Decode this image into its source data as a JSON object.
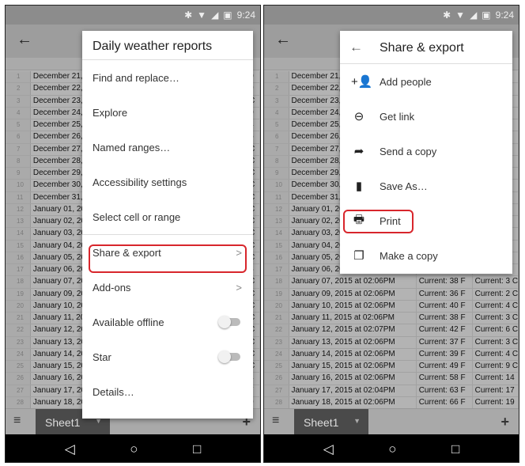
{
  "status": {
    "time": "9:24",
    "icons": [
      "bluetooth-icon",
      "wifi-icon",
      "signal-icon",
      "battery-icon"
    ]
  },
  "colors": {
    "highlight": "#d8262c"
  },
  "rows": [
    {
      "n": "1",
      "a": "December 21,",
      "tail": "0"
    },
    {
      "n": "2",
      "a": "December 22,",
      "tail": "9"
    },
    {
      "n": "3",
      "a": "December 23,",
      "tail": "C"
    },
    {
      "n": "4",
      "a": "December 24,",
      "tail": "0"
    },
    {
      "n": "5",
      "a": "December 25,",
      "tail": "4"
    },
    {
      "n": "6",
      "a": "December 26,",
      "tail": "5"
    },
    {
      "n": "7",
      "a": "December 27,",
      "tail": "C"
    },
    {
      "n": "8",
      "a": "December 28,",
      "tail": "C"
    },
    {
      "n": "9",
      "a": "December 29,",
      "tail": "C"
    },
    {
      "n": "10",
      "a": "December 30,",
      "tail": "C"
    },
    {
      "n": "11",
      "a": "December 31,",
      "tail": "C"
    },
    {
      "n": "12",
      "a": "January 01, 20",
      "tail": "C"
    },
    {
      "n": "13",
      "a": "January 02, 20",
      "tail": "C"
    },
    {
      "n": "14",
      "a": "January 03, 20",
      "tail": "C"
    },
    {
      "n": "15",
      "a": "January 04, 20",
      "tail": "C"
    },
    {
      "n": "16",
      "a": "January 05, 20",
      "tail": "C"
    },
    {
      "n": "17",
      "a": "January 06, 20",
      "tail": "3",
      "c": "3"
    },
    {
      "n": "18",
      "a": "January 07, 2015 at 02:06PM",
      "b": "Current: 38 F",
      "c": "Current: 3 C",
      "tail": "C"
    },
    {
      "n": "19",
      "a": "January 09, 2015 at 02:06PM",
      "b": "Current: 36 F",
      "c": "Current: 2 C",
      "tail": "C"
    },
    {
      "n": "20",
      "a": "January 10, 2015 at 02:06PM",
      "b": "Current: 40 F",
      "c": "Current: 4 C",
      "tail": "C"
    },
    {
      "n": "21",
      "a": "January 11, 2015 at 02:06PM",
      "b": "Current: 38 F",
      "c": "Current: 3 C",
      "tail": "C"
    },
    {
      "n": "22",
      "a": "January 12, 2015 at 02:07PM",
      "b": "Current: 42 F",
      "c": "Current: 6 C",
      "tail": "C"
    },
    {
      "n": "23",
      "a": "January 13, 2015 at 02:06PM",
      "b": "Current: 37 F",
      "c": "Current: 3 C",
      "tail": "C"
    },
    {
      "n": "24",
      "a": "January 14, 2015 at 02:06PM",
      "b": "Current: 39 F",
      "c": "Current: 4 C",
      "tail": "C"
    },
    {
      "n": "25",
      "a": "January 15, 2015 at 02:06PM",
      "b": "Current: 49 F",
      "c": "Current: 9 C",
      "tail": "C"
    },
    {
      "n": "26",
      "a": "January 16, 2015 at 02:06PM",
      "b": "Current: 58 F",
      "c": "Current: 14",
      "tail": "4"
    },
    {
      "n": "27",
      "a": "January 17, 2015 at 02:04PM",
      "b": "Current: 63 F",
      "c": "Current: 17",
      "tail": "7"
    },
    {
      "n": "28",
      "a": "January 18, 2015 at 02:06PM",
      "b": "Current: 66 F",
      "c": "Current: 19",
      "tail": "9"
    }
  ],
  "sheet_tab": "Sheet1",
  "menu1": {
    "title": "Daily weather reports",
    "items": [
      {
        "label": "Find and replace…"
      },
      {
        "label": "Explore"
      },
      {
        "label": "Named ranges…"
      },
      {
        "label": "Accessibility settings"
      },
      {
        "label": "Select cell or range"
      },
      {
        "label": "Share & export",
        "chevron": true,
        "highlight": true,
        "divider": true
      },
      {
        "label": "Add-ons",
        "chevron": true
      },
      {
        "label": "Available offline",
        "toggle": false
      },
      {
        "label": "Star",
        "toggle": false
      },
      {
        "label": "Details…"
      }
    ]
  },
  "menu2": {
    "title": "Share & export",
    "items": [
      {
        "label": "Add people",
        "icon": "add-person-icon",
        "glyph": "+👤"
      },
      {
        "label": "Get link",
        "icon": "link-icon",
        "glyph": "⊖"
      },
      {
        "label": "Send a copy",
        "icon": "share-arrow-icon",
        "glyph": "➦"
      },
      {
        "label": "Save As…",
        "icon": "file-icon",
        "glyph": "▮"
      },
      {
        "label": "Print",
        "icon": "printer-icon",
        "glyph": "🖶",
        "highlight": true
      },
      {
        "label": "Make a copy",
        "icon": "copy-icon",
        "glyph": "❐"
      }
    ]
  }
}
